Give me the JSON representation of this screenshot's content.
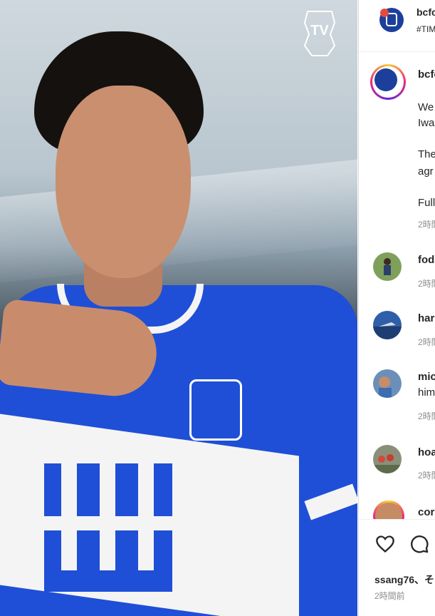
{
  "header": {
    "username": "bcfc",
    "tag": "#TIM"
  },
  "media": {
    "badge": "TV"
  },
  "caption": {
    "username": "bcfc",
    "line1": "We",
    "line2": "Iwa",
    "line3": "The",
    "line4": "agr",
    "line5": "Full",
    "time": "2時間"
  },
  "comments": [
    {
      "username": "fod",
      "time": "2時間"
    },
    {
      "username": "har",
      "time": "2時間"
    },
    {
      "username": "mic",
      "text": "him",
      "time": "2時間"
    },
    {
      "username": "hoa",
      "time": "2時間"
    },
    {
      "username": "cor"
    }
  ],
  "footer": {
    "likes": "ssang76、そ",
    "time": "2時間前"
  },
  "colors": {
    "brand_blue": "#1f4fd6",
    "story_ring": "#ee2a7b",
    "muted": "#8e8e8e"
  },
  "icons": {
    "like": "heart-icon",
    "comment": "comment-icon",
    "badge": "tv-badge-icon"
  }
}
